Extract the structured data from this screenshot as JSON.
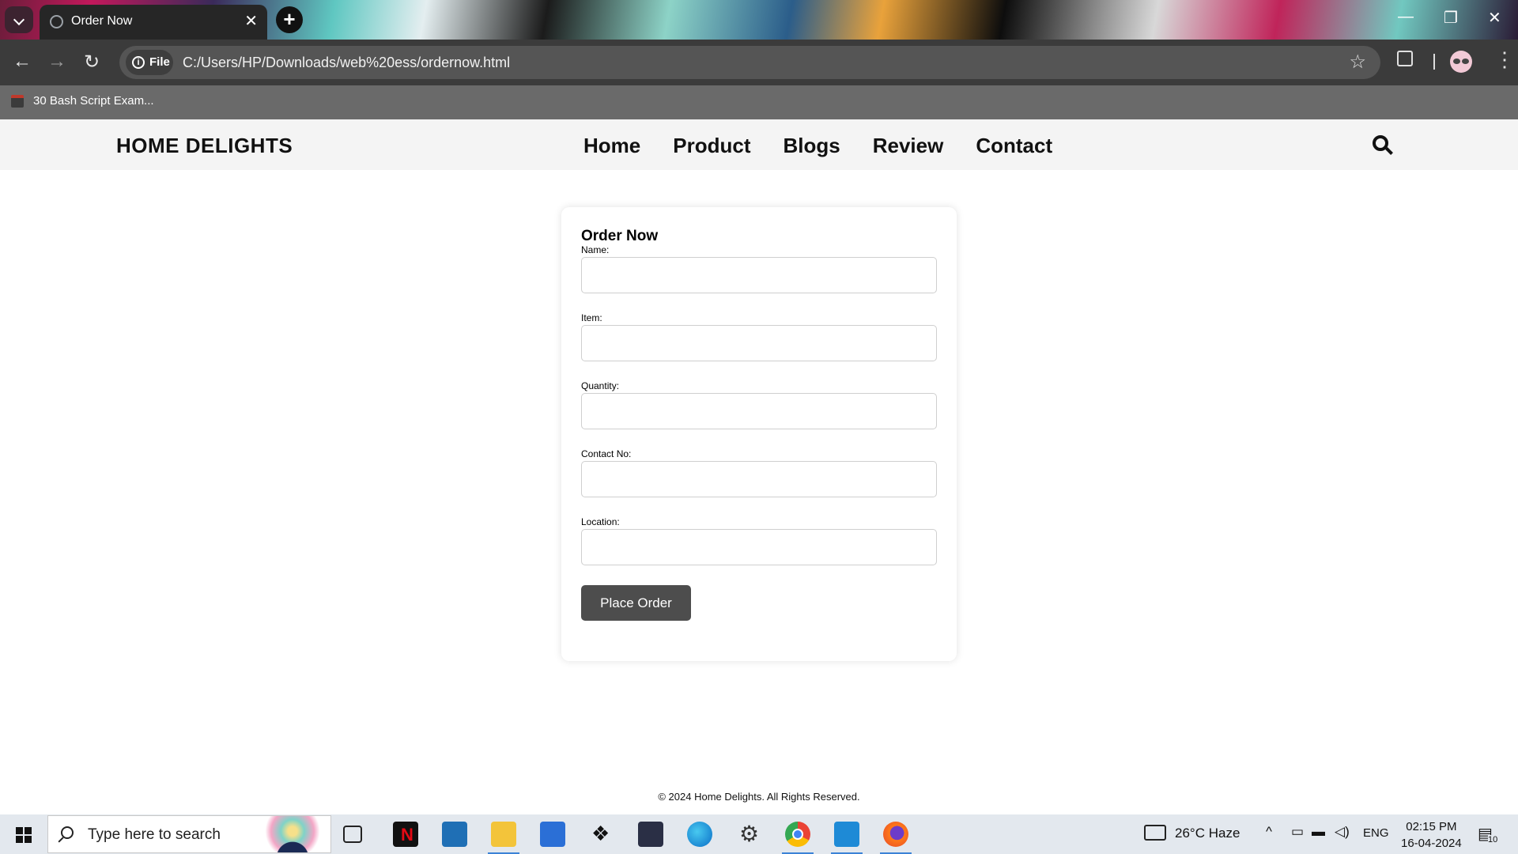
{
  "browser": {
    "tab_title": "Order Now",
    "address_chip": "File",
    "url": "C:/Users/HP/Downloads/web%20ess/ordernow.html",
    "bookmarks": [
      {
        "label": "30 Bash Script Exam..."
      }
    ]
  },
  "site": {
    "brand": "HOME DELIGHTS",
    "nav": [
      "Home",
      "Product",
      "Blogs",
      "Review",
      "Contact"
    ]
  },
  "form": {
    "title": "Order Now",
    "fields": [
      {
        "label": "Name:",
        "value": ""
      },
      {
        "label": "Item:",
        "value": ""
      },
      {
        "label": "Quantity:",
        "value": ""
      },
      {
        "label": "Contact No:",
        "value": ""
      },
      {
        "label": "Location:",
        "value": ""
      }
    ],
    "submit_label": "Place Order"
  },
  "footer": {
    "text": "© 2024 Home Delights. All Rights Reserved."
  },
  "taskbar": {
    "search_placeholder": "Type here to search",
    "weather": "26°C  Haze",
    "language": "ENG",
    "time": "02:15 PM",
    "date": "16-04-2024",
    "notification_count": "10",
    "apps": [
      "task-view",
      "netflix",
      "prime-video",
      "file-explorer",
      "microsoft-store",
      "dropbox",
      "powershell",
      "edge",
      "settings",
      "chrome",
      "vscode",
      "firefox"
    ]
  },
  "colors": {
    "nav_bg": "#f4f4f4",
    "button_bg": "#4d4d4d",
    "toolbar_bg": "#3b3b3b"
  }
}
